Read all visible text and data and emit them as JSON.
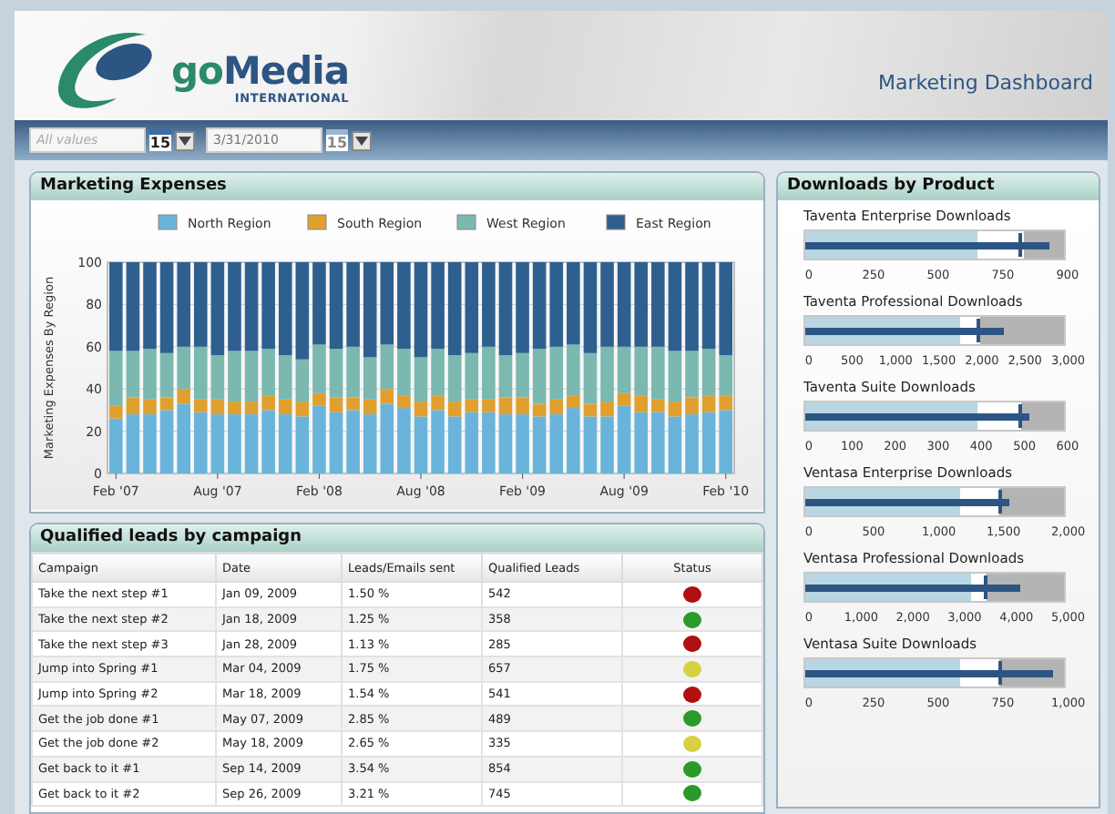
{
  "header": {
    "logo_parts": [
      "go",
      "Media"
    ],
    "logo_subtitle": "INTERNATIONAL",
    "title": "Marketing Dashboard"
  },
  "toolbar": {
    "start_field": {
      "placeholder": "All values",
      "calendar_day": "15"
    },
    "end_field": {
      "value": "3/31/2010",
      "calendar_day": "15"
    }
  },
  "marketing_expenses": {
    "title": "Marketing Expenses",
    "chart_data": {
      "type": "bar",
      "stacked": true,
      "grid": true,
      "legend": true,
      "ylabel": "Marketing Expenses By Region",
      "ylim": [
        0,
        100
      ],
      "yticks": [
        0,
        20,
        40,
        60,
        80,
        100
      ],
      "categories": [
        "Feb '07",
        null,
        null,
        null,
        null,
        null,
        "Aug '07",
        null,
        null,
        null,
        null,
        null,
        "Feb '08",
        null,
        null,
        null,
        null,
        null,
        "Aug '08",
        null,
        null,
        null,
        null,
        null,
        "Feb '09",
        null,
        null,
        null,
        null,
        null,
        "Aug '09",
        null,
        null,
        null,
        null,
        null,
        "Feb '10"
      ],
      "series": [
        {
          "name": "North Region",
          "color": "#6ab4dc",
          "values": [
            26,
            28,
            28,
            30,
            33,
            29,
            28,
            28,
            28,
            30,
            28,
            27,
            32,
            29,
            30,
            28,
            33,
            31,
            27,
            30,
            27,
            29,
            29,
            28,
            28,
            27,
            28,
            31,
            27,
            27,
            32,
            29,
            29,
            27,
            28,
            29,
            30
          ]
        },
        {
          "name": "South Region",
          "color": "#e0a030",
          "values": [
            6,
            8,
            7,
            6,
            7,
            6,
            7,
            6,
            6,
            7,
            7,
            7,
            6,
            7,
            6,
            7,
            7,
            6,
            7,
            7,
            7,
            6,
            6,
            8,
            8,
            6,
            7,
            6,
            6,
            7,
            6,
            8,
            6,
            7,
            8,
            8,
            7
          ]
        },
        {
          "name": "West Region",
          "color": "#7ab8b0",
          "values": [
            26,
            22,
            24,
            21,
            20,
            25,
            21,
            24,
            24,
            22,
            21,
            20,
            23,
            23,
            24,
            20,
            21,
            22,
            21,
            22,
            22,
            22,
            25,
            20,
            21,
            26,
            25,
            24,
            24,
            26,
            22,
            23,
            25,
            24,
            22,
            22,
            19
          ]
        },
        {
          "name": "East Region",
          "color": "#2f5f8f",
          "values": [
            42,
            42,
            41,
            43,
            40,
            40,
            44,
            42,
            42,
            41,
            44,
            46,
            39,
            41,
            40,
            45,
            39,
            41,
            45,
            41,
            44,
            43,
            40,
            44,
            43,
            41,
            40,
            39,
            43,
            40,
            40,
            40,
            40,
            42,
            42,
            41,
            44
          ]
        }
      ]
    }
  },
  "leads": {
    "title": "Qualified leads by campaign",
    "columns": [
      "Campaign",
      "Date",
      "Leads/Emails sent",
      "Qualified Leads",
      "Status"
    ],
    "rows": [
      {
        "campaign": "Take the next step #1",
        "date": "Jan 09, 2009",
        "rate": "1.50 %",
        "qualified": "542",
        "color": "#b01010"
      },
      {
        "campaign": "Take the next step #2",
        "date": "Jan 18, 2009",
        "rate": "1.25 %",
        "qualified": "358",
        "color": "#2a9a2a"
      },
      {
        "campaign": "Take the next step #3",
        "date": "Jan 28, 2009",
        "rate": "1.13 %",
        "qualified": "285",
        "color": "#b01010"
      },
      {
        "campaign": "Jump into Spring #1",
        "date": "Mar 04, 2009",
        "rate": "1.75 %",
        "qualified": "657",
        "color": "#d8d040"
      },
      {
        "campaign": "Jump into Spring #2",
        "date": "Mar 18, 2009",
        "rate": "1.54 %",
        "qualified": "541",
        "color": "#b01010"
      },
      {
        "campaign": "Get the job done #1",
        "date": "May 07, 2009",
        "rate": "2.85 %",
        "qualified": "489",
        "color": "#2a9a2a"
      },
      {
        "campaign": "Get the job done #2",
        "date": "May 18, 2009",
        "rate": "2.65 %",
        "qualified": "335",
        "color": "#d8d040"
      },
      {
        "campaign": "Get back to it #1",
        "date": "Sep 14, 2009",
        "rate": "3.54 %",
        "qualified": "854",
        "color": "#2a9a2a"
      },
      {
        "campaign": "Get back to it #2",
        "date": "Sep 26, 2009",
        "rate": "3.21 %",
        "qualified": "745",
        "color": "#2a9a2a"
      }
    ]
  },
  "downloads": {
    "title": "Downloads by Product",
    "bullets": [
      {
        "title": "Taventa Enterprise Downloads",
        "measure": {
          "level": 0.944
        },
        "ticks": [
          "0",
          "250",
          "500",
          "750",
          "900"
        ]
      },
      {
        "title": "Taventa Professional Downloads",
        "measure": {
          "level": 0.767
        },
        "ticks": [
          "0",
          "500",
          "1,000",
          "1,500",
          "2,000",
          "2,500",
          "3,000"
        ]
      },
      {
        "title": "Taventa Suite Downloads",
        "measure": {
          "level": 0.867
        },
        "ticks": [
          "0",
          "100",
          "200",
          "300",
          "400",
          "500",
          "600"
        ]
      },
      {
        "title": "Ventasa Enterprise Downloads",
        "measure": {
          "level": 0.79
        },
        "ticks": [
          "0",
          "500",
          "1,000",
          "1,500",
          "2,000"
        ]
      },
      {
        "title": "Ventasa Professional Downloads",
        "measure": {
          "level": 0.83
        },
        "ticks": [
          "0",
          "1,000",
          "2,000",
          "3,000",
          "4,000",
          "5,000"
        ]
      },
      {
        "title": "Ventasa Suite Downloads",
        "measure": {
          "level": 0.96
        },
        "ticks": [
          "0",
          "250",
          "500",
          "750",
          "1,000"
        ]
      }
    ]
  }
}
